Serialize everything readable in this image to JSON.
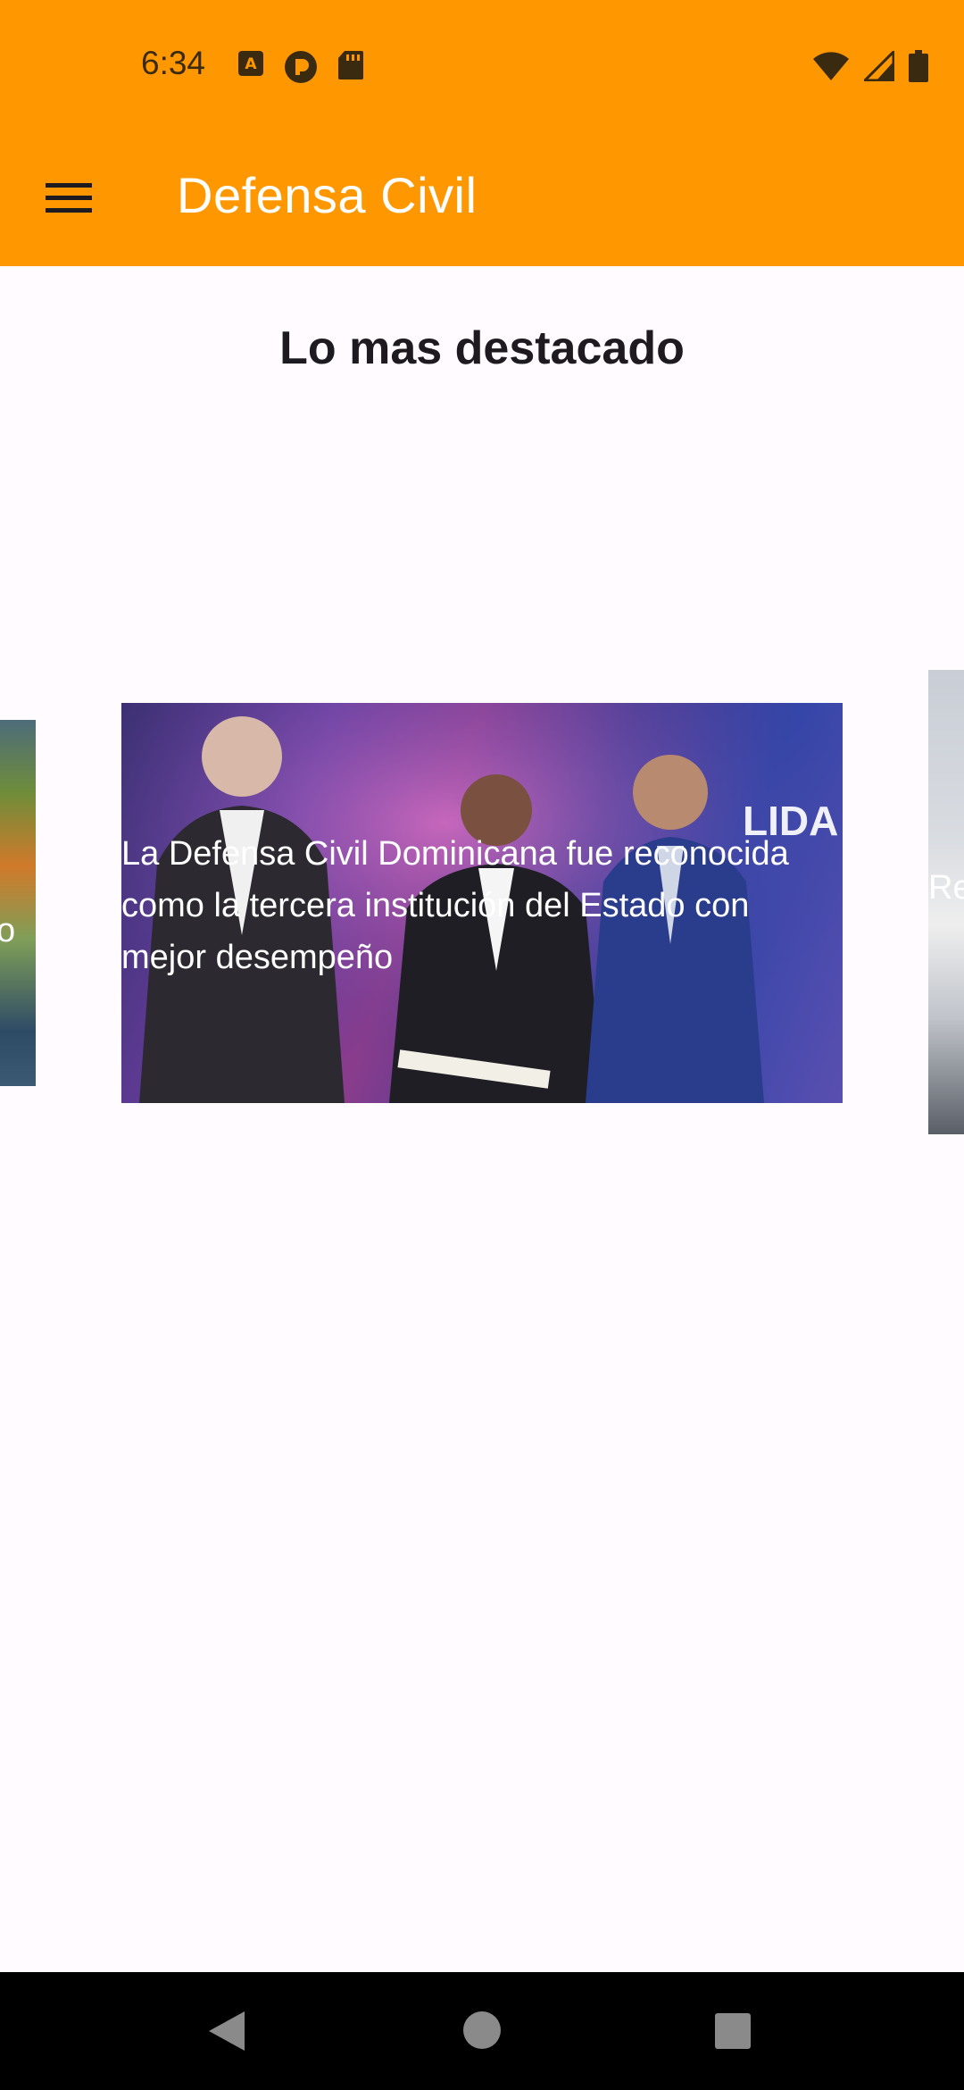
{
  "status_bar": {
    "time": "6:34",
    "left_icons": [
      "keyboard-a-icon",
      "pocket-casts-icon",
      "sd-card-icon"
    ],
    "right_icons": [
      "wifi-icon",
      "cellular-signal-icon",
      "battery-icon"
    ]
  },
  "app_bar": {
    "title": "Defensa Civil",
    "menu_icon": "hamburger-menu-icon",
    "color": "#ff9800"
  },
  "main": {
    "heading": "Lo mas destacado",
    "carousel": {
      "slides": [
        {
          "caption": "o"
        },
        {
          "caption": "La Defensa Civil Dominicana fue reconocida como la tercera institución del Estado con mejor desempeño"
        },
        {
          "caption": "Re de"
        }
      ],
      "photo_banner_text": "LIDA Pil para Int de"
    }
  },
  "nav_bar": {
    "icons": [
      "back-icon",
      "home-icon",
      "recents-icon"
    ]
  }
}
